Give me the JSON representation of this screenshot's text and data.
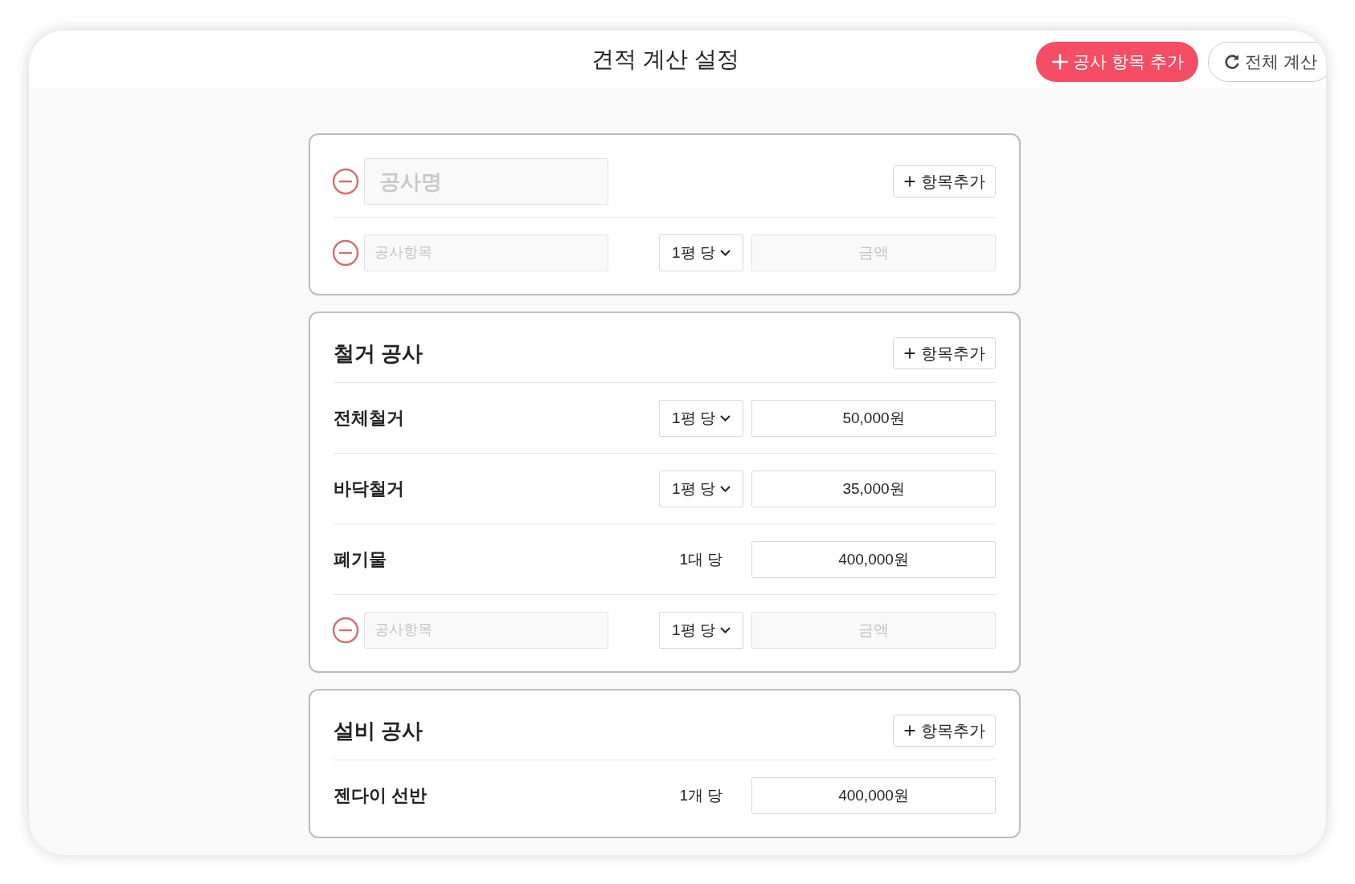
{
  "window": {
    "title": "견적 계산 설정"
  },
  "toolbar": {
    "add_section_button": "공사 항목 추가",
    "recalc_button": "전체 계산"
  },
  "sections": [
    {
      "kind": "new",
      "name_placeholder": "공사명",
      "add_item_button": "항목추가",
      "items": [
        {
          "kind": "new",
          "name_placeholder": "공사항목",
          "unit": "1평 당",
          "dropdown": true,
          "amount_placeholder": "금액"
        }
      ]
    },
    {
      "kind": "fixed",
      "name": "철거 공사",
      "add_item_button": "항목추가",
      "items": [
        {
          "kind": "fixed",
          "name": "전체철거",
          "unit": "1평 당",
          "dropdown": true,
          "amount": "50,000원"
        },
        {
          "kind": "fixed",
          "name": "바닥철거",
          "unit": "1평 당",
          "dropdown": true,
          "amount": "35,000원"
        },
        {
          "kind": "fixed",
          "name": "폐기물",
          "unit": "1대 당",
          "dropdown": false,
          "amount": "400,000원"
        },
        {
          "kind": "new",
          "name_placeholder": "공사항목",
          "unit": "1평 당",
          "dropdown": true,
          "amount_placeholder": "금액"
        }
      ]
    },
    {
      "kind": "fixed",
      "name": "설비 공사",
      "add_item_button": "항목추가",
      "items": [
        {
          "kind": "fixed",
          "name": "젠다이 선반",
          "unit": "1개 당",
          "dropdown": false,
          "amount": "400,000원"
        }
      ]
    }
  ]
}
